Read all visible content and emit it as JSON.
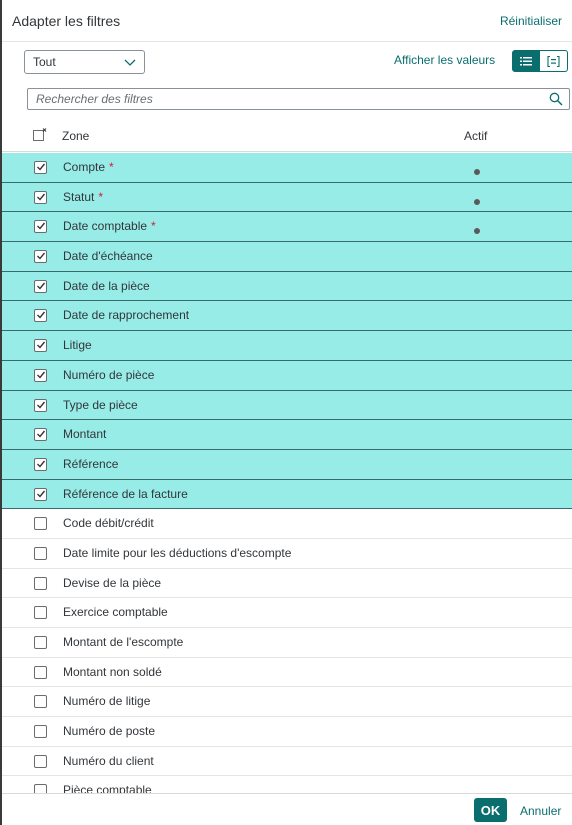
{
  "dialog": {
    "title": "Adapter les filtres",
    "reset_label": "Réinitialiser"
  },
  "toolbar": {
    "select_value": "Tout",
    "show_values_label": "Afficher les valeurs",
    "view_list_icon": "list-icon",
    "view_values_icon": "bracket-list-icon"
  },
  "search": {
    "placeholder": "Rechercher des filtres",
    "icon": "search-icon"
  },
  "columns": {
    "zone": "Zone",
    "actif": "Actif"
  },
  "rows": [
    {
      "label": "Compte",
      "checked": true,
      "required": true,
      "active": true
    },
    {
      "label": "Statut",
      "checked": true,
      "required": true,
      "active": true
    },
    {
      "label": "Date comptable",
      "checked": true,
      "required": true,
      "active": true
    },
    {
      "label": "Date d'échéance",
      "checked": true,
      "required": false,
      "active": false
    },
    {
      "label": "Date de la pièce",
      "checked": true,
      "required": false,
      "active": false
    },
    {
      "label": "Date de rapprochement",
      "checked": true,
      "required": false,
      "active": false
    },
    {
      "label": "Litige",
      "checked": true,
      "required": false,
      "active": false
    },
    {
      "label": "Numéro de pièce",
      "checked": true,
      "required": false,
      "active": false
    },
    {
      "label": "Type de pièce",
      "checked": true,
      "required": false,
      "active": false
    },
    {
      "label": "Montant",
      "checked": true,
      "required": false,
      "active": false
    },
    {
      "label": "Référence",
      "checked": true,
      "required": false,
      "active": false
    },
    {
      "label": "Référence de la facture",
      "checked": true,
      "required": false,
      "active": false
    },
    {
      "label": "Code débit/crédit",
      "checked": false,
      "required": false,
      "active": false
    },
    {
      "label": "Date limite pour les déductions d'escompte",
      "checked": false,
      "required": false,
      "active": false
    },
    {
      "label": "Devise de la pièce",
      "checked": false,
      "required": false,
      "active": false
    },
    {
      "label": "Exercice comptable",
      "checked": false,
      "required": false,
      "active": false
    },
    {
      "label": "Montant de l'escompte",
      "checked": false,
      "required": false,
      "active": false
    },
    {
      "label": "Montant non soldé",
      "checked": false,
      "required": false,
      "active": false
    },
    {
      "label": "Numéro de litige",
      "checked": false,
      "required": false,
      "active": false
    },
    {
      "label": "Numéro de poste",
      "checked": false,
      "required": false,
      "active": false
    },
    {
      "label": "Numéro du client",
      "checked": false,
      "required": false,
      "active": false
    },
    {
      "label": "Pièce comptable",
      "checked": false,
      "required": false,
      "active": false
    }
  ],
  "required_marker": "*",
  "footer": {
    "ok_label": "OK",
    "cancel_label": "Annuler"
  },
  "colors": {
    "accent": "#0a6e6e",
    "selected_row": "#97ece7",
    "required": "#d32030"
  }
}
